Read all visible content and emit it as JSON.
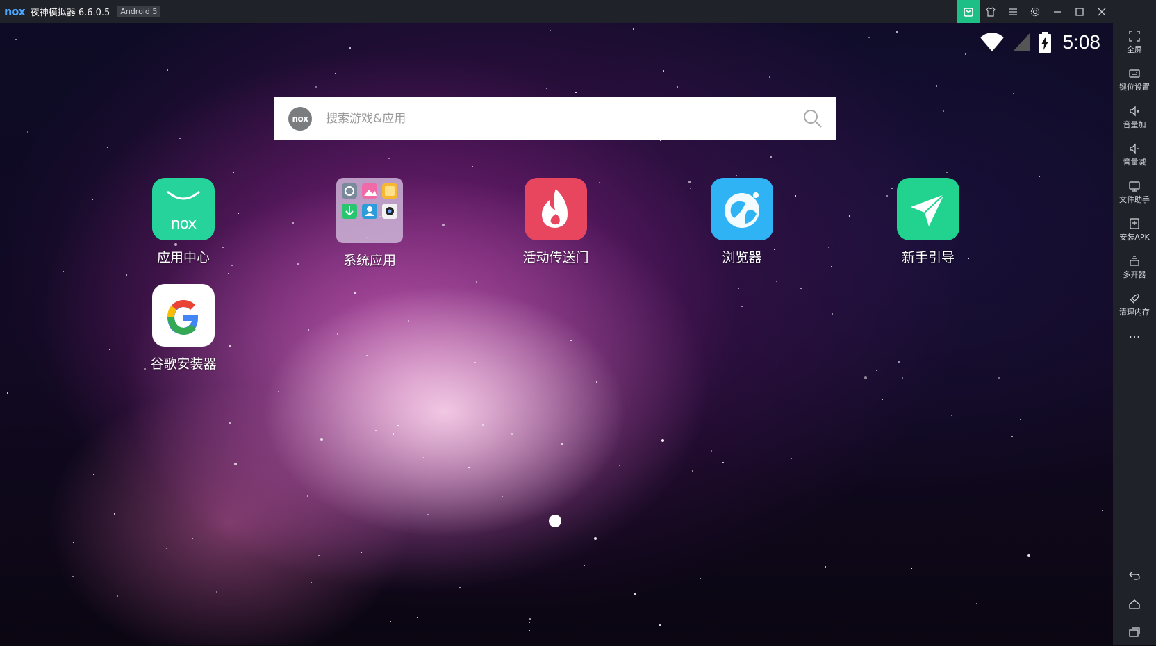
{
  "titlebar": {
    "logo": "nox",
    "app_title": "夜神模拟器 6.6.0.5",
    "android_badge": "Android 5"
  },
  "statusbar": {
    "time": "5:08",
    "icons": [
      "wifi-icon",
      "signal-icon",
      "battery-charging-icon"
    ]
  },
  "search": {
    "logo_text": "nox",
    "placeholder": "搜索游戏&应用"
  },
  "apps": [
    {
      "label": "应用中心",
      "icon": "nox-app-center-icon",
      "color": "#26d39a"
    },
    {
      "label": "系统应用",
      "icon": "system-apps-folder-icon",
      "color": "#b99ac0"
    },
    {
      "label": "活动传送门",
      "icon": "fire-icon",
      "color": "#e8455f"
    },
    {
      "label": "浏览器",
      "icon": "browser-globe-icon",
      "color": "#2fb3f5"
    },
    {
      "label": "新手引导",
      "icon": "paper-plane-icon",
      "color": "#22d38f"
    },
    {
      "label": "谷歌安装器",
      "icon": "google-icon",
      "color": "#ffffff"
    }
  ],
  "sidebar": {
    "items": [
      {
        "label": "全屏",
        "icon": "fullscreen-icon"
      },
      {
        "label": "键位设置",
        "icon": "keyboard-icon"
      },
      {
        "label": "音量加",
        "icon": "volume-up-icon"
      },
      {
        "label": "音量减",
        "icon": "volume-down-icon"
      },
      {
        "label": "文件助手",
        "icon": "file-helper-icon"
      },
      {
        "label": "安装APK",
        "icon": "install-apk-icon"
      },
      {
        "label": "多开器",
        "icon": "multi-instance-icon"
      },
      {
        "label": "清理内存",
        "icon": "rocket-icon"
      }
    ],
    "more": "···",
    "nav": [
      "back-icon",
      "home-icon",
      "recents-icon"
    ]
  },
  "colors": {
    "titlebar_bg": "#1f2229",
    "store_accent": "#1dbf86"
  }
}
